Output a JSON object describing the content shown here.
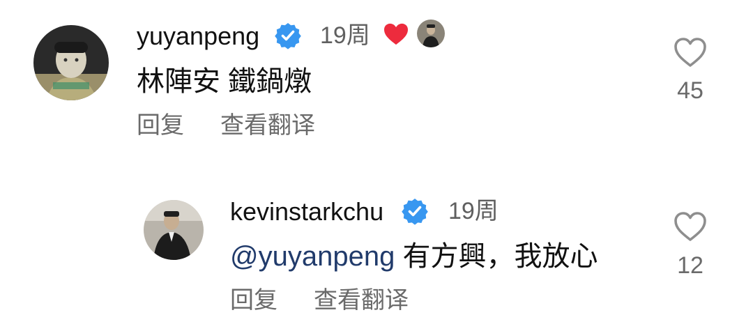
{
  "comments": [
    {
      "username": "yuyanpeng",
      "time": "19周",
      "text": "林陣安 鐵鍋燉",
      "reply_label": "回复",
      "translate_label": "查看翻译",
      "likes": "45",
      "icons": [
        "verified-badge-icon",
        "heart-filled-icon",
        "author-like-avatar"
      ]
    },
    {
      "username": "kevinstarkchu",
      "time": "19周",
      "mention": "@yuyanpeng",
      "text": " 有方興，我放心",
      "reply_label": "回复",
      "translate_label": "查看翻译",
      "likes": "12",
      "icons": [
        "verified-badge-icon"
      ]
    }
  ],
  "colors": {
    "verified_blue": "#3897f0",
    "liked_heart_red": "#ed2b3d",
    "mention_blue": "#213b6b",
    "secondary_text": "#6a6a6a"
  }
}
